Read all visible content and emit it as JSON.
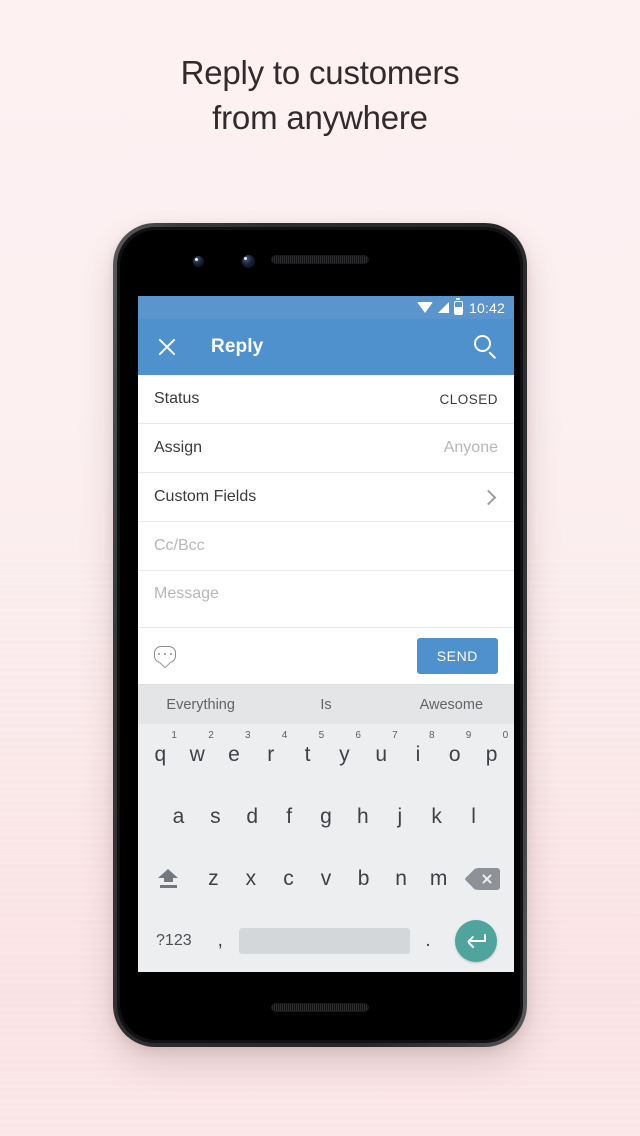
{
  "page": {
    "headline_line1": "Reply to customers",
    "headline_line2": "from anywhere",
    "background_top_color": "#fdf1f2",
    "background_bottom_color": "#fae3e4",
    "headline_color": "#322b2e"
  },
  "status_bar": {
    "time": "10:42",
    "wifi_icon": "wifi-icon",
    "signal_icon": "signal-icon",
    "battery_icon": "battery-icon"
  },
  "app_bar": {
    "close_icon": "close-icon",
    "title": "Reply",
    "search_icon": "search-icon",
    "background_color": "#4f91cd"
  },
  "form": {
    "rows": [
      {
        "label": "Status",
        "value": "CLOSED",
        "kind": "value"
      },
      {
        "label": "Assign",
        "value": "Anyone",
        "kind": "muted"
      },
      {
        "label": "Custom Fields",
        "value": "",
        "kind": "chevron"
      },
      {
        "label": "Cc/Bcc",
        "value": "",
        "kind": "placeholder"
      },
      {
        "label": "Message",
        "value": "",
        "kind": "placeholder"
      }
    ]
  },
  "action_bar": {
    "canned_response_icon": "chat-bubble-icon",
    "send_label": "SEND",
    "send_color": "#4f91cd"
  },
  "keyboard": {
    "suggestions": [
      "Everything",
      "Is",
      "Awesome"
    ],
    "row1": [
      {
        "key": "q",
        "num": "1"
      },
      {
        "key": "w",
        "num": "2"
      },
      {
        "key": "e",
        "num": "3"
      },
      {
        "key": "r",
        "num": "4"
      },
      {
        "key": "t",
        "num": "5"
      },
      {
        "key": "y",
        "num": "6"
      },
      {
        "key": "u",
        "num": "7"
      },
      {
        "key": "i",
        "num": "8"
      },
      {
        "key": "o",
        "num": "9"
      },
      {
        "key": "p",
        "num": "0"
      }
    ],
    "row2": [
      "a",
      "s",
      "d",
      "f",
      "g",
      "h",
      "j",
      "k",
      "l"
    ],
    "row3": [
      "z",
      "x",
      "c",
      "v",
      "b",
      "n",
      "m"
    ],
    "shift_icon": "shift-icon",
    "backspace_icon": "backspace-icon",
    "symbols_label": "?123",
    "comma_label": ",",
    "period_label": ".",
    "space_label": "",
    "enter_icon": "enter-icon",
    "enter_color": "#4fa49d",
    "background_color": "#eceef0",
    "suggestion_strip_color": "#e3e5e6"
  }
}
